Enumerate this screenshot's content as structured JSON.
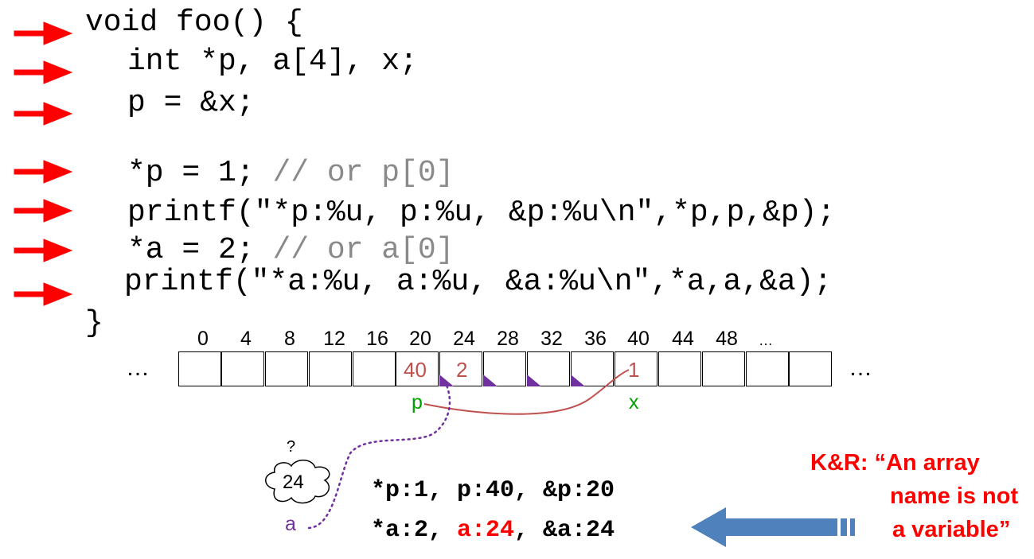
{
  "code": {
    "line1": "void foo() {",
    "line2": "int *p, a[4], x;",
    "line3": "p = &x;",
    "line4_code": "*p = 1; ",
    "line4_comment": "// or p[0]",
    "line5": "printf(\"*p:%u, p:%u, &p:%u\\n\",*p,p,&p);",
    "line6_code": "*a = 2; ",
    "line6_comment": "// or a[0]",
    "line7": "printf(\"*a:%u, a:%u, &a:%u\\n\",*a,a,&a);",
    "line8": "}"
  },
  "memory": {
    "addresses": [
      "0",
      "4",
      "8",
      "12",
      "16",
      "20",
      "24",
      "28",
      "32",
      "36",
      "40",
      "44",
      "48",
      "…"
    ],
    "ellipsis_left": "…",
    "ellipsis_right": "…",
    "cell_p_value": "40",
    "cell_a0_value": "2",
    "cell_x_value": "1",
    "label_p": "p",
    "label_x": "x"
  },
  "cloud": {
    "question": "?",
    "value": "24",
    "label_a": "a"
  },
  "output": {
    "line1": "*p:1, p:40, &p:20",
    "line2_prefix": "*a:2, ",
    "line2_highlight": "a:24",
    "line2_suffix": ", &a:24"
  },
  "quote": {
    "line1": "K&R: “An array",
    "line2": "name is not",
    "line3": "a variable”"
  },
  "colors": {
    "arrow": "#ff0000",
    "pointer": "#c0504d",
    "purple": "#7030a0",
    "green": "#00a000",
    "blue_arrow": "#4f81bd"
  }
}
